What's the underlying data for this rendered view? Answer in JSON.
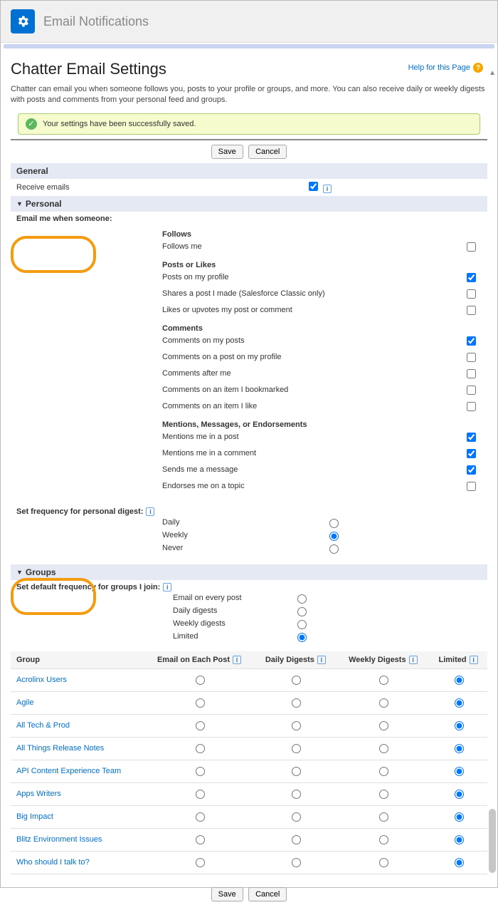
{
  "header": {
    "title": "Email Notifications"
  },
  "helpLink": "Help for this Page",
  "page": {
    "title": "Chatter Email Settings",
    "description": "Chatter can email you when someone follows you, posts to your profile or groups, and more. You can also receive daily or weekly digests with posts and comments from your personal feed and groups."
  },
  "banner": {
    "text": "Your settings have been successfully saved."
  },
  "buttons": {
    "save": "Save",
    "cancel": "Cancel"
  },
  "sections": {
    "general": {
      "title": "General",
      "receiveEmails": {
        "label": "Receive emails",
        "checked": true
      }
    },
    "personal": {
      "title": "Personal",
      "emailMeWhen": "Email me when someone:",
      "groups": [
        {
          "heading": "Follows",
          "items": [
            {
              "label": "Follows me",
              "checked": false
            }
          ]
        },
        {
          "heading": "Posts or Likes",
          "items": [
            {
              "label": "Posts on my profile",
              "checked": true
            },
            {
              "label": "Shares a post I made (Salesforce Classic only)",
              "checked": false
            },
            {
              "label": "Likes or upvotes my post or comment",
              "checked": false
            }
          ]
        },
        {
          "heading": "Comments",
          "items": [
            {
              "label": "Comments on my posts",
              "checked": true
            },
            {
              "label": "Comments on a post on my profile",
              "checked": false
            },
            {
              "label": "Comments after me",
              "checked": false
            },
            {
              "label": "Comments on an item I bookmarked",
              "checked": false
            },
            {
              "label": "Comments on an item I like",
              "checked": false
            }
          ]
        },
        {
          "heading": "Mentions, Messages, or Endorsements",
          "items": [
            {
              "label": "Mentions me in a post",
              "checked": true
            },
            {
              "label": "Mentions me in a comment",
              "checked": true
            },
            {
              "label": "Sends me a message",
              "checked": true
            },
            {
              "label": "Endorses me on a topic",
              "checked": false
            }
          ]
        }
      ],
      "digestLabel": "Set frequency for personal digest:",
      "digestOptions": [
        "Daily",
        "Weekly",
        "Never"
      ],
      "digestSelected": "Weekly"
    },
    "groupsSection": {
      "title": "Groups",
      "defaultFreqLabel": "Set default frequency for groups I join:",
      "defaultOptions": [
        "Email on every post",
        "Daily digests",
        "Weekly digests",
        "Limited"
      ],
      "defaultSelected": "Limited",
      "tableHeaders": {
        "group": "Group",
        "each": "Email on Each Post",
        "daily": "Daily Digests",
        "weekly": "Weekly Digests",
        "limited": "Limited"
      },
      "rows": [
        {
          "name": "Acrolinx Users",
          "selected": "limited"
        },
        {
          "name": "Agile",
          "selected": "limited"
        },
        {
          "name": "All Tech & Prod",
          "selected": "limited"
        },
        {
          "name": "All Things Release Notes",
          "selected": "limited"
        },
        {
          "name": "API Content Experience Team",
          "selected": "limited"
        },
        {
          "name": "Apps Writers",
          "selected": "limited"
        },
        {
          "name": "Big Impact",
          "selected": "limited"
        },
        {
          "name": "Blitz Environment Issues",
          "selected": "limited"
        },
        {
          "name": "Who should I talk to?",
          "selected": "limited"
        }
      ]
    }
  }
}
